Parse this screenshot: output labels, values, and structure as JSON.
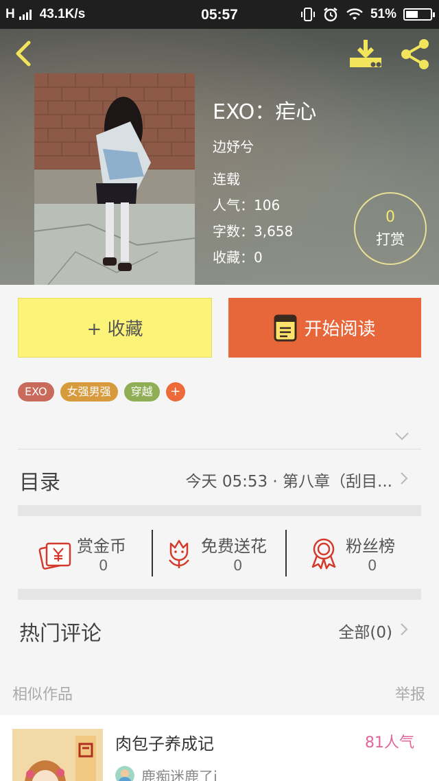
{
  "status_bar": {
    "network": "H",
    "speed": "43.1K/s",
    "time": "05:57",
    "battery": "51%",
    "battery_level": 0.51,
    "icons": [
      "vibrate-icon",
      "alarm-icon",
      "wifi-icon",
      "battery-icon"
    ]
  },
  "nav": {
    "icons": [
      "back-arrow-icon",
      "download-icon",
      "share-icon"
    ],
    "accent_color": "#f2e55c"
  },
  "book": {
    "title": "EXO：疟心",
    "author": "边妤兮",
    "status": "连载",
    "popularity": "人气：106",
    "word_count": "字数：3,658",
    "favorites": "收藏：0"
  },
  "reward": {
    "count": "0",
    "label": "打赏"
  },
  "actions": {
    "favorite_label": "+ 收藏",
    "read_label": "开始阅读",
    "favorite_color": "#fbf478",
    "read_color": "#e8673a"
  },
  "tags": [
    {
      "label": "EXO",
      "color": "#c96b5c"
    },
    {
      "label": "女强男强",
      "color": "#d79a3c"
    },
    {
      "label": "穿越",
      "color": "#8fae55"
    }
  ],
  "tag_add_label": "+",
  "toc": {
    "label": "目录",
    "latest": "今天 05:53 · 第八章（刮目..."
  },
  "stats": [
    {
      "name": "赏金币",
      "count": "0",
      "icon": "red-envelope-icon"
    },
    {
      "name": "免费送花",
      "count": "0",
      "icon": "flower-icon"
    },
    {
      "name": "粉丝榜",
      "count": "0",
      "icon": "medal-icon"
    }
  ],
  "comments": {
    "label": "热门评论",
    "all_label": "全部(0)"
  },
  "similar": {
    "label": "相似作品",
    "report_label": "举报",
    "items": [
      {
        "title": "肉包子养成记",
        "popularity": "81人气",
        "author": "鹿痴迷鹿了i"
      }
    ]
  }
}
